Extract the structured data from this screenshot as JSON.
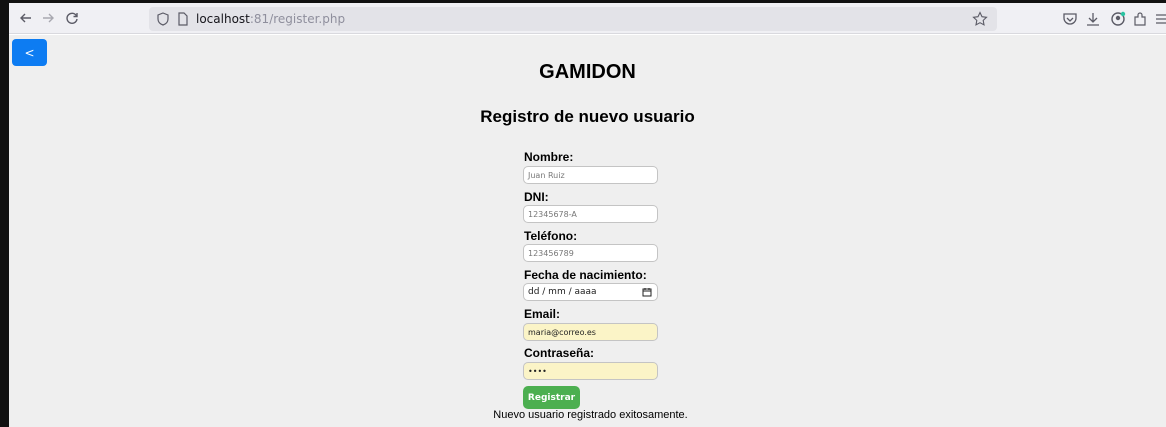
{
  "browser": {
    "url_host": "localhost",
    "url_rest": ":81/register.php"
  },
  "icons": {
    "back": "arrow-left-icon",
    "forward": "arrow-right-icon",
    "reload": "reload-icon",
    "tracking": "shield-icon",
    "page": "page-icon",
    "bookmark": "star-icon",
    "pocket": "pocket-icon",
    "download": "download-icon",
    "account": "account-icon",
    "extensions": "extensions-icon",
    "menu": "hamburger-menu-icon"
  },
  "page": {
    "back_label": "<",
    "site_title": "GAMIDON",
    "form_title": "Registro de nuevo usuario",
    "fields": {
      "name": {
        "label": "Nombre:",
        "placeholder": "Juan Ruiz"
      },
      "dni": {
        "label": "DNI:",
        "placeholder": "12345678-A"
      },
      "phone": {
        "label": "Teléfono:",
        "placeholder": "123456789"
      },
      "birth": {
        "label": "Fecha de nacimiento:",
        "value": "dd / mm / aaaa"
      },
      "email": {
        "label": "Email:",
        "value": "maria@correo.es"
      },
      "password": {
        "label": "Contraseña:",
        "value": "••••"
      }
    },
    "submit_label": "Registrar",
    "success_message": "Nuevo usuario registrado exitosamente."
  },
  "colors": {
    "back_button": "#0d7cf2",
    "submit_button": "#4caf50",
    "autofill": "#fbf4c7",
    "page_bg": "#efefef"
  }
}
